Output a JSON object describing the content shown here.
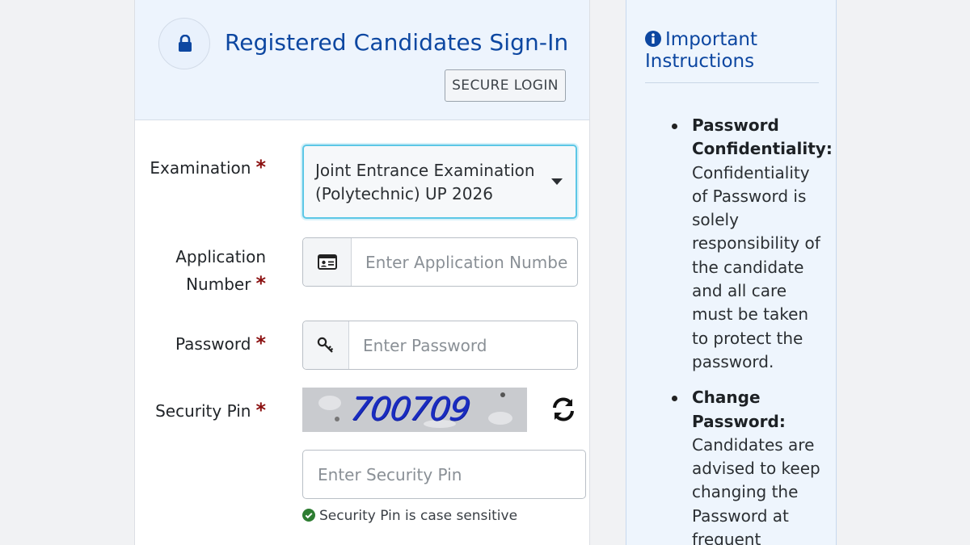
{
  "login": {
    "title": "Registered Candidates Sign-In",
    "badge": "SECURE LOGIN",
    "lock_icon": "lock-icon"
  },
  "form": {
    "examination_label": "Examination",
    "examination_value": "Joint Entrance Examination (Polytechnic) UP 2026",
    "application_label_line1": "Application",
    "application_label_line2": "Number",
    "application_placeholder": "Enter Application Number",
    "application_icon": "id-card-icon",
    "password_label": "Password",
    "password_placeholder": "Enter Password",
    "password_icon": "key-icon",
    "security_pin_label": "Security Pin",
    "captcha_code": "700709",
    "refresh_icon": "refresh-icon",
    "pin_placeholder": "Enter Security Pin",
    "pin_help": "Security Pin is case sensitive",
    "required_mark": "*"
  },
  "instructions": {
    "title_line1": "Important",
    "title_line2": "Instructions",
    "items": [
      {
        "heading": "Password Confidentiality:",
        "text": "Confidentiality of Password is solely responsibility of the candidate and all care must be taken to protect the password."
      },
      {
        "heading": "Change Password:",
        "text": "Candidates are advised to keep changing the Password at frequent"
      }
    ]
  },
  "colors": {
    "brand": "#0d47a1",
    "required": "#8b1010",
    "focus": "#5cc7e6",
    "success": "#2e7d32"
  }
}
